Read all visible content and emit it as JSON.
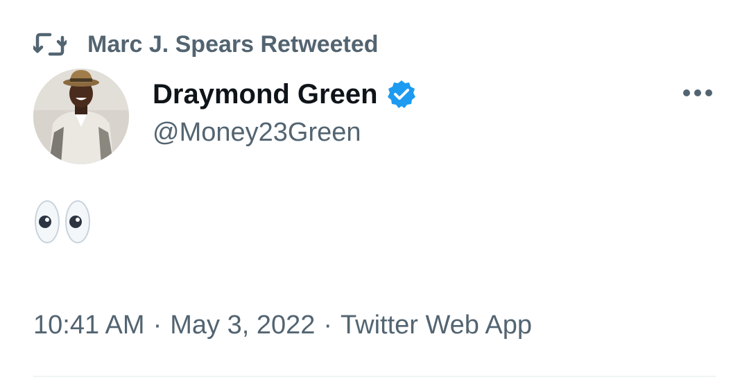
{
  "retweet": {
    "icon": "retweet-icon",
    "text": "Marc J. Spears Retweeted"
  },
  "author": {
    "display_name": "Draymond Green",
    "handle": "@Money23Green",
    "verified_icon": "verified-badge-icon",
    "avatar": "profile-photo"
  },
  "tweet": {
    "content_icon": "eyes-emoji-icon"
  },
  "meta": {
    "time": "10:41 AM",
    "date": "May 3, 2022",
    "source": "Twitter Web App",
    "separator": "·"
  },
  "more_icon": "more-options-icon",
  "colors": {
    "primary_text": "#0f1419",
    "secondary_text": "#536471",
    "verified_blue": "#1d9bf0",
    "divider": "#eff3f4"
  }
}
